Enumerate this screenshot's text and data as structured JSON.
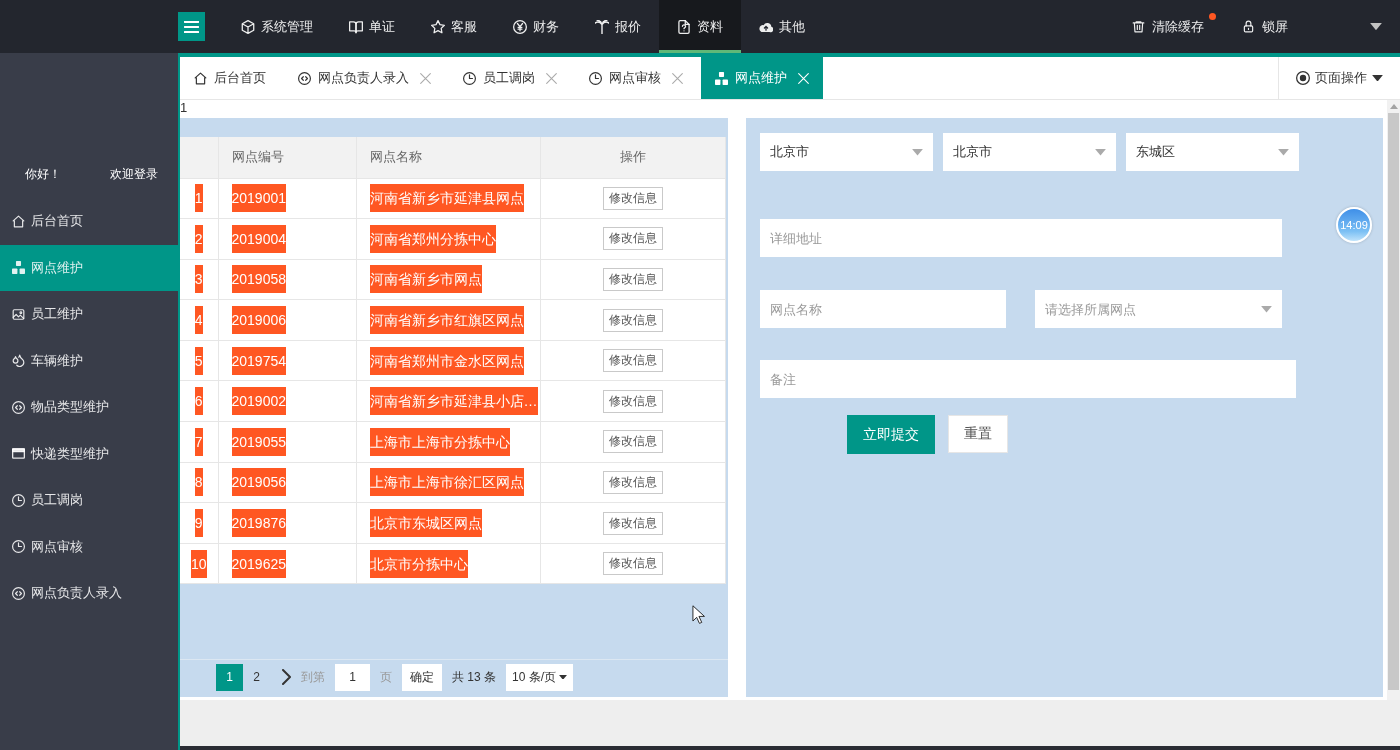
{
  "header": {
    "nav": [
      {
        "label": "系统管理",
        "selected": false
      },
      {
        "label": "单证",
        "selected": false
      },
      {
        "label": "客服",
        "selected": false
      },
      {
        "label": "财务",
        "selected": false
      },
      {
        "label": "报价",
        "selected": false
      },
      {
        "label": "资料",
        "selected": true
      },
      {
        "label": "其他",
        "selected": false
      }
    ],
    "actions": [
      {
        "label": "清除缓存",
        "dot": true
      },
      {
        "label": "锁屏",
        "dot": false
      }
    ]
  },
  "sidebar": {
    "greeting": "你好！",
    "welcome": "欢迎登录",
    "items": [
      {
        "label": "后台首页",
        "selected": false
      },
      {
        "label": "网点维护",
        "selected": true
      },
      {
        "label": "员工维护",
        "selected": false
      },
      {
        "label": "车辆维护",
        "selected": false
      },
      {
        "label": "物品类型维护",
        "selected": false
      },
      {
        "label": "快递类型维护",
        "selected": false
      },
      {
        "label": "员工调岗",
        "selected": false
      },
      {
        "label": "网点审核",
        "selected": false
      },
      {
        "label": "网点负责人录入",
        "selected": false
      }
    ]
  },
  "tabs": {
    "items": [
      {
        "label": "后台首页",
        "closable": false,
        "selected": false
      },
      {
        "label": "网点负责人录入",
        "closable": true,
        "selected": false
      },
      {
        "label": "员工调岗",
        "closable": true,
        "selected": false
      },
      {
        "label": "网点审核",
        "closable": true,
        "selected": false
      },
      {
        "label": "网点维护",
        "closable": true,
        "selected": true
      }
    ],
    "page_actions": "页面操作"
  },
  "content": {
    "marker": "1"
  },
  "table": {
    "columns": [
      "网点编号",
      "网点名称",
      "操作"
    ],
    "rows": [
      {
        "index": "1",
        "code": "2019001",
        "name": "河南省新乡市延津县网点",
        "action": "修改信息"
      },
      {
        "index": "2",
        "code": "2019004",
        "name": "河南省郑州分拣中心",
        "action": "修改信息"
      },
      {
        "index": "3",
        "code": "2019058",
        "name": "河南省新乡市网点",
        "action": "修改信息"
      },
      {
        "index": "4",
        "code": "2019006",
        "name": "河南省新乡市红旗区网点",
        "action": "修改信息"
      },
      {
        "index": "5",
        "code": "2019754",
        "name": "河南省郑州市金水区网点",
        "action": "修改信息"
      },
      {
        "index": "6",
        "code": "2019002",
        "name": "河南省新乡市延津县小店…",
        "action": "修改信息"
      },
      {
        "index": "7",
        "code": "2019055",
        "name": "上海市上海市分拣中心",
        "action": "修改信息"
      },
      {
        "index": "8",
        "code": "2019056",
        "name": "上海市上海市徐汇区网点",
        "action": "修改信息"
      },
      {
        "index": "9",
        "code": "2019876",
        "name": "北京市东城区网点",
        "action": "修改信息"
      },
      {
        "index": "10",
        "code": "2019625",
        "name": "北京市分拣中心",
        "action": "修改信息"
      }
    ]
  },
  "pagination": {
    "pages": [
      {
        "label": "1",
        "selected": true
      },
      {
        "label": "2",
        "selected": false
      }
    ],
    "goto_label": "到第",
    "goto_value": "1",
    "page_unit": "页",
    "confirm": "确定",
    "total": "共 13 条",
    "page_size": "10 条/页"
  },
  "form": {
    "regions": [
      {
        "value": "北京市"
      },
      {
        "value": "北京市"
      },
      {
        "value": "东城区"
      }
    ],
    "address": {
      "placeholder": "详细地址"
    },
    "name": {
      "placeholder": "网点名称"
    },
    "branch": {
      "placeholder": "请选择所属网点"
    },
    "remark": {
      "placeholder": "备注"
    },
    "buttons": [
      {
        "label": "立即提交",
        "kind": "primary"
      },
      {
        "label": "重置",
        "kind": "default"
      }
    ]
  },
  "clock": {
    "time": "14:09"
  }
}
